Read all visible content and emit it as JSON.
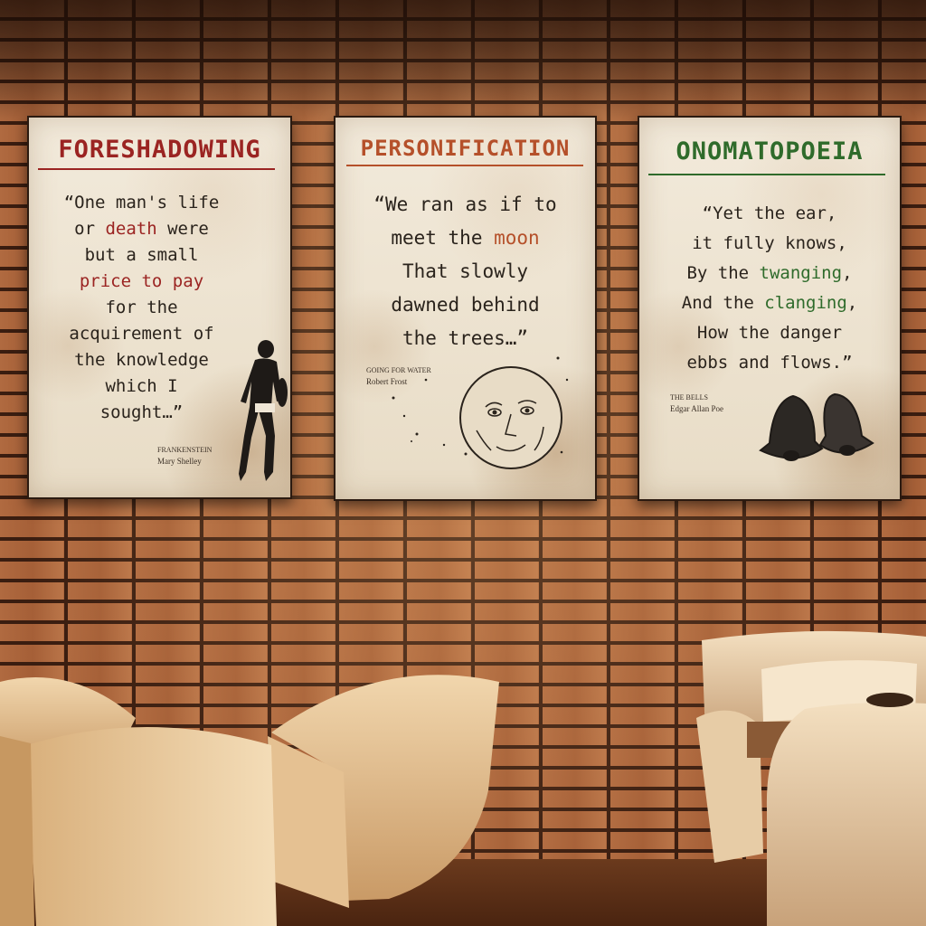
{
  "scene": {
    "description_elements": [
      "brick-wall",
      "three-framed-posters",
      "armchairs",
      "sofa"
    ]
  },
  "posters": [
    {
      "title": "FORESHADOWING",
      "title_color": "#9b2422",
      "quote_lines": [
        [
          "“One man's life"
        ],
        [
          "or ",
          {
            "hl": "death"
          },
          " were"
        ],
        [
          "but a small"
        ],
        [
          {
            "hl": "price to pay"
          }
        ],
        [
          "for the"
        ],
        [
          "acquirement of"
        ],
        [
          "the knowledge"
        ],
        [
          "which I"
        ],
        [
          "sought…”"
        ]
      ],
      "credit_work": "FRANKENSTEIN",
      "credit_author": "Mary Shelley",
      "illustration": "standing-man-icon"
    },
    {
      "title": "PERSONIFICATION",
      "title_color": "#b5502a",
      "quote_lines": [
        [
          "“We ran as if to"
        ],
        [
          "meet the ",
          {
            "hl": "moon"
          }
        ],
        [
          "That slowly"
        ],
        [
          "dawned behind"
        ],
        [
          "the trees…”"
        ]
      ],
      "credit_work": "GOING FOR WATER",
      "credit_author": "Robert Frost",
      "illustration": "moon-face-icon"
    },
    {
      "title": "ONOMATOPOEIA",
      "title_color": "#2f6b2b",
      "quote_lines": [
        [
          "“Yet the ear,"
        ],
        [
          "it fully knows,"
        ],
        [
          "By the ",
          {
            "hl": "twanging"
          },
          ","
        ],
        [
          "And the ",
          {
            "hl": "clanging"
          },
          ","
        ],
        [
          "How the danger"
        ],
        [
          "ebbs and flows.”"
        ]
      ],
      "credit_work": "THE BELLS",
      "credit_author": "Edgar Allan Poe",
      "illustration": "bells-icon"
    }
  ],
  "colors": {
    "brick": "#a55f37",
    "mortar": "#3a1d10",
    "poster_paper": "#efe6d6",
    "chair_upholstery": "#e8c9a0"
  }
}
